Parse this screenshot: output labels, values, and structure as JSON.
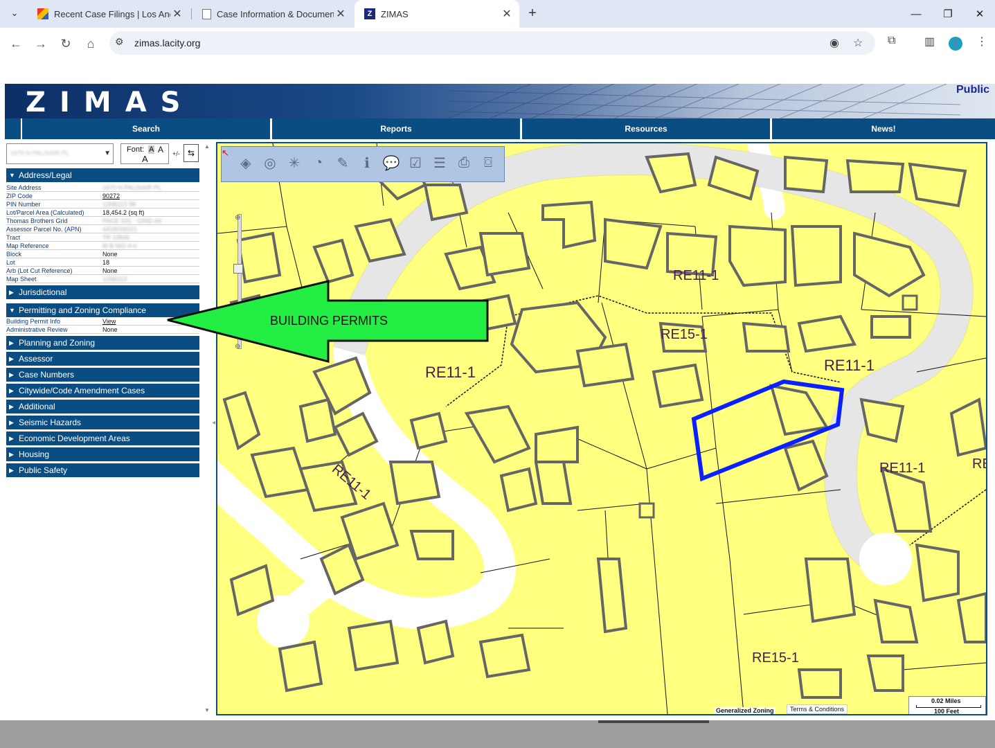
{
  "browser": {
    "tabs": [
      {
        "title": "Recent Case Filings | Los Angele",
        "favicon": "color-blocks-icon"
      },
      {
        "title": "Case Information & Documents",
        "favicon": "document-icon"
      },
      {
        "title": "ZIMAS",
        "favicon": "z-logo-icon"
      }
    ],
    "url": "zimas.lacity.org"
  },
  "zimas": {
    "logo": "ZIMAS",
    "public_label": "Public",
    "nav": [
      "Search",
      "Reports",
      "Resources",
      "News!"
    ]
  },
  "panel": {
    "address_value": "1670 N PALISAIR PL",
    "font_label": "Font:",
    "font_a": "A",
    "plus_minus": "+/-",
    "sections": {
      "address_legal": "Address/Legal",
      "jurisdictional": "Jurisdictional",
      "permitting": "Permitting and Zoning Compliance",
      "planning": "Planning and Zoning",
      "assessor": "Assessor",
      "case_numbers": "Case Numbers",
      "citywide": "Citywide/Code Amendment Cases",
      "additional": "Additional",
      "seismic": "Seismic Hazards",
      "economic": "Economic Development Areas",
      "housing": "Housing",
      "public_safety": "Public Safety"
    },
    "address_rows": [
      {
        "k": "Site Address",
        "v": "1670 N PALISAIR PL"
      },
      {
        "k": "ZIP Code",
        "v": "90272"
      },
      {
        "k": "PIN Number",
        "v": "126B113 98"
      },
      {
        "k": "Lot/Parcel Area (Calculated)",
        "v": "18,454.2 (sq ft)"
      },
      {
        "k": "Thomas Brothers Grid",
        "v": "PAGE 631 - GRID A6"
      },
      {
        "k": "Assessor Parcel No. (APN)",
        "v": "4416026021"
      },
      {
        "k": "Tract",
        "v": "TR 19845"
      },
      {
        "k": "Map Reference",
        "v": "M B 562-4-6"
      },
      {
        "k": "Block",
        "v": "None"
      },
      {
        "k": "Lot",
        "v": "18"
      },
      {
        "k": "Arb (Lot Cut Reference)",
        "v": "None"
      },
      {
        "k": "Map Sheet",
        "v": "126B113"
      }
    ],
    "permit_rows": [
      {
        "k": "Building Permit Info",
        "v": "View"
      },
      {
        "k": "Administrative Review",
        "v": "None"
      }
    ]
  },
  "map": {
    "zones": [
      "RE11-1",
      "RE15-1",
      "RE11-1",
      "RE11-1",
      "RE11-1",
      "RE11-1",
      "RE15-1",
      "RE"
    ],
    "annotation": "BUILDING PERMITS",
    "scale_miles": "0.02 Miles",
    "scale_feet": "100 Feet",
    "generalized_zoning": "Generalized Zoning",
    "terms": "Terms & Conditions"
  }
}
